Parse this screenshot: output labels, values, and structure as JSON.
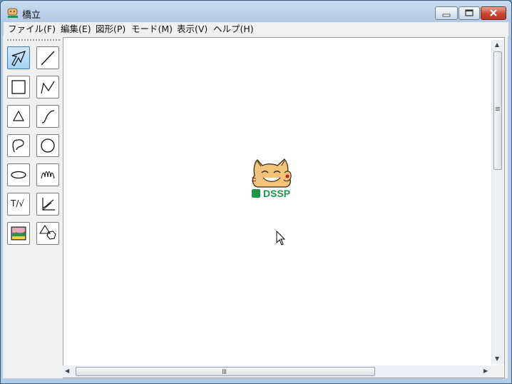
{
  "window": {
    "title": "橋立",
    "app_icon": "dssp-cat-icon"
  },
  "controls": {
    "minimize": "minimize-icon",
    "maximize": "maximize-icon",
    "close": "close-icon"
  },
  "menubar": {
    "items": [
      {
        "label": "ファイル(F)"
      },
      {
        "label": "編集(E)"
      },
      {
        "label": "図形(P)"
      },
      {
        "label": "モード(M)"
      },
      {
        "label": "表示(V)"
      },
      {
        "label": "ヘルプ(H)"
      }
    ]
  },
  "toolbox": {
    "tools": [
      {
        "name": "select-tool",
        "icon": "select-arrow-icon",
        "selected": true
      },
      {
        "name": "line-tool",
        "icon": "line-icon"
      },
      {
        "name": "rectangle-tool",
        "icon": "rectangle-icon"
      },
      {
        "name": "polyline-tool",
        "icon": "polyline-icon"
      },
      {
        "name": "triangle-tool",
        "icon": "triangle-icon"
      },
      {
        "name": "curve-tool",
        "icon": "curve-icon"
      },
      {
        "name": "freeform-tool",
        "icon": "freeform-icon"
      },
      {
        "name": "circle-tool",
        "icon": "circle-icon"
      },
      {
        "name": "ellipse-tool",
        "icon": "ellipse-icon"
      },
      {
        "name": "spiral-tool",
        "icon": "spiral-icon"
      },
      {
        "name": "text-formula-tool",
        "icon": "text-formula-icon",
        "label": "T/√"
      },
      {
        "name": "graph-tool",
        "icon": "graph-axes-icon"
      },
      {
        "name": "image-tool",
        "icon": "picture-icon"
      },
      {
        "name": "solid-shape-tool",
        "icon": "solid-shape-icon"
      }
    ]
  },
  "canvas": {
    "logo_text": "DSSP"
  },
  "accent_colors": {
    "logo_green": "#1a9a48",
    "close_red": "#c8462f",
    "selected_tool": "#a6d3f4"
  }
}
